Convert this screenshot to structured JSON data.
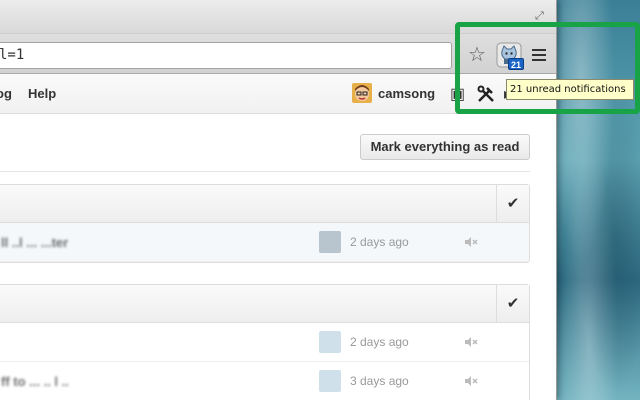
{
  "browser": {
    "url_text": "l=1",
    "extension_badge": "21",
    "tooltip": "21 unread notifications"
  },
  "header": {
    "nav": [
      {
        "label": "og"
      },
      {
        "label": "Help"
      }
    ],
    "username": "camsong"
  },
  "content": {
    "mark_all_label": "Mark everything as read",
    "groups": [
      {
        "rows": [
          {
            "title": "ll ..l ... ...ter",
            "time": "2 days ago"
          }
        ]
      },
      {
        "rows": [
          {
            "title": "",
            "time": "2 days ago"
          },
          {
            "title": "ff to ... .. l ..",
            "time": "3 days ago"
          }
        ]
      }
    ]
  },
  "colors": {
    "highlight": "#17a346",
    "badge": "#1a64c8",
    "tooltip_bg": "#ffffca"
  }
}
